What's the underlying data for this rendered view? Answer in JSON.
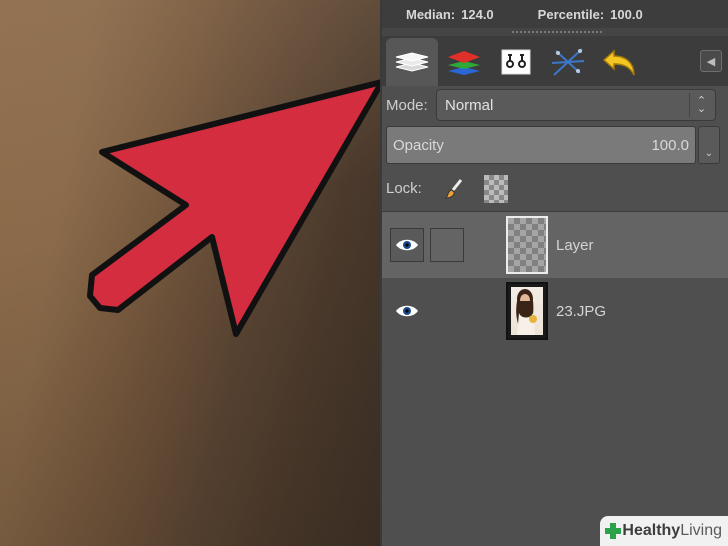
{
  "stats": {
    "median_label": "Median:",
    "median_value": "124.0",
    "percentile_label": "Percentile:",
    "percentile_value": "100.0"
  },
  "tabs": [
    {
      "name": "layers",
      "icon": "layers-icon"
    },
    {
      "name": "channels",
      "icon": "channels-icon"
    },
    {
      "name": "paths",
      "icon": "paths-icon"
    },
    {
      "name": "colormap",
      "icon": "colormap-icon"
    },
    {
      "name": "undo-history",
      "icon": "undo-icon"
    }
  ],
  "mode": {
    "label": "Mode:",
    "value": "Normal"
  },
  "opacity": {
    "label": "Opacity",
    "value": "100.0"
  },
  "lock": {
    "label": "Lock:"
  },
  "layers": [
    {
      "name": "Layer",
      "visible": true,
      "selected": true
    },
    {
      "name": "23.JPG",
      "visible": true,
      "selected": false
    }
  ],
  "watermark": {
    "healthy": "Healthy",
    "living": "Living"
  },
  "colors": {
    "arrow_fill": "#d42d3f",
    "panel": "#4f4f4f",
    "selected_row": "#646464"
  }
}
